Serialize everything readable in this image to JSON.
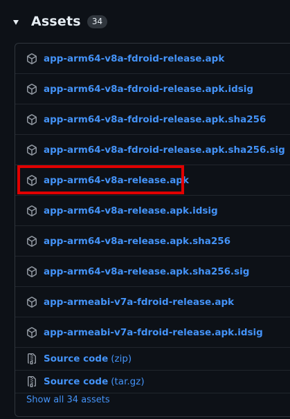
{
  "header": {
    "title": "Assets",
    "count": "34"
  },
  "assets": [
    {
      "name": "app-arm64-v8a-fdroid-release.apk"
    },
    {
      "name": "app-arm64-v8a-fdroid-release.apk.idsig"
    },
    {
      "name": "app-arm64-v8a-fdroid-release.apk.sha256"
    },
    {
      "name": "app-arm64-v8a-fdroid-release.apk.sha256.sig"
    },
    {
      "name": "app-arm64-v8a-release.apk"
    },
    {
      "name": "app-arm64-v8a-release.apk.idsig"
    },
    {
      "name": "app-arm64-v8a-release.apk.sha256"
    },
    {
      "name": "app-arm64-v8a-release.apk.sha256.sig"
    },
    {
      "name": "app-armeabi-v7a-fdroid-release.apk"
    },
    {
      "name": "app-armeabi-v7a-fdroid-release.apk.idsig"
    }
  ],
  "source": [
    {
      "label": "Source code",
      "ext": "(zip)"
    },
    {
      "label": "Source code",
      "ext": "(tar.gz)"
    }
  ],
  "footer": {
    "show_all": "Show all 34 assets"
  },
  "colors": {
    "background": "#0d1117",
    "link": "#4493f8",
    "highlight": "#e00000"
  },
  "icons": {
    "asset": "package-icon",
    "source": "file-zip-icon",
    "toggle": "triangle-down-icon"
  }
}
